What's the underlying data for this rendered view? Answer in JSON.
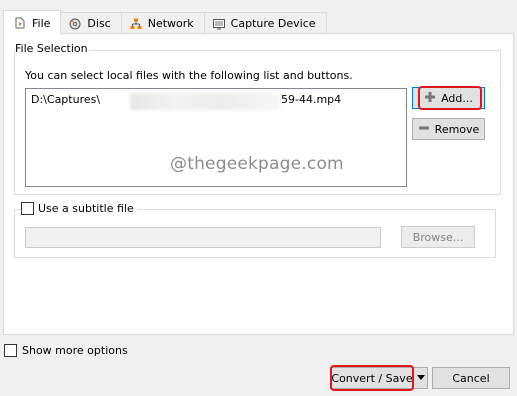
{
  "tabs": [
    {
      "label": "File",
      "icon": "file-play-icon",
      "active": true
    },
    {
      "label": "Disc",
      "icon": "disc-icon",
      "active": false
    },
    {
      "label": "Network",
      "icon": "network-icon",
      "active": false
    },
    {
      "label": "Capture Device",
      "icon": "capture-device-icon",
      "active": false
    }
  ],
  "file_selection": {
    "title": "File Selection",
    "description": "You can select local files with the following list and buttons.",
    "files": [
      {
        "path_start": "D:\\Captures\\",
        "path_end": "59-44.mp4"
      }
    ],
    "add_label": "Add...",
    "remove_label": "Remove"
  },
  "watermark": "@thegeekpage.com",
  "subtitle": {
    "label": "Use a subtitle file",
    "checked": false,
    "path_value": "",
    "browse_label": "Browse..."
  },
  "footer": {
    "show_more_label": "Show more options",
    "show_more_checked": false,
    "convert_label": "Convert / Save",
    "cancel_label": "Cancel"
  },
  "colors": {
    "highlight": "#e0171a",
    "focus_border": "#0078d7"
  }
}
